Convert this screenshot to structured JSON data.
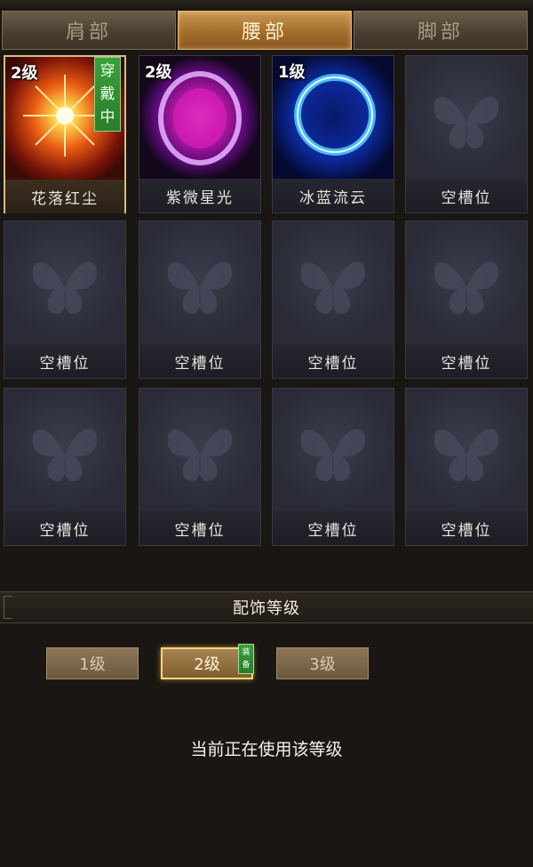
{
  "tabs": [
    {
      "label": "肩部",
      "active": false
    },
    {
      "label": "腰部",
      "active": true
    },
    {
      "label": "脚部",
      "active": false
    }
  ],
  "slots": [
    {
      "name": "花落红尘",
      "level": "2级",
      "badge": "穿戴中",
      "art": "red-burst"
    },
    {
      "name": "紫微星光",
      "level": "2级",
      "badge": "",
      "art": "purple-orb"
    },
    {
      "name": "冰蓝流云",
      "level": "1级",
      "badge": "",
      "art": "blue-ring"
    },
    {
      "name": "空槽位",
      "level": "",
      "badge": "",
      "art": "butterfly"
    },
    {
      "name": "空槽位",
      "level": "",
      "badge": "",
      "art": "butterfly"
    },
    {
      "name": "空槽位",
      "level": "",
      "badge": "",
      "art": "butterfly"
    },
    {
      "name": "空槽位",
      "level": "",
      "badge": "",
      "art": "butterfly"
    },
    {
      "name": "空槽位",
      "level": "",
      "badge": "",
      "art": "butterfly"
    },
    {
      "name": "空槽位",
      "level": "",
      "badge": "",
      "art": "butterfly"
    },
    {
      "name": "空槽位",
      "level": "",
      "badge": "",
      "art": "butterfly"
    },
    {
      "name": "空槽位",
      "level": "",
      "badge": "",
      "art": "butterfly"
    },
    {
      "name": "空槽位",
      "level": "",
      "badge": "",
      "art": "butterfly"
    }
  ],
  "level_section": {
    "title": "配饰等级",
    "buttons": [
      {
        "label": "1级",
        "active": false
      },
      {
        "label": "2级",
        "active": true
      },
      {
        "label": "3级",
        "active": false
      }
    ],
    "equip_badge": "装备",
    "status_text": "当前正在使用该等级"
  },
  "colors": {
    "tab_active": "#a7702e",
    "wearing_badge": "#2b7d2b",
    "selected_border": "#d7bd82"
  }
}
